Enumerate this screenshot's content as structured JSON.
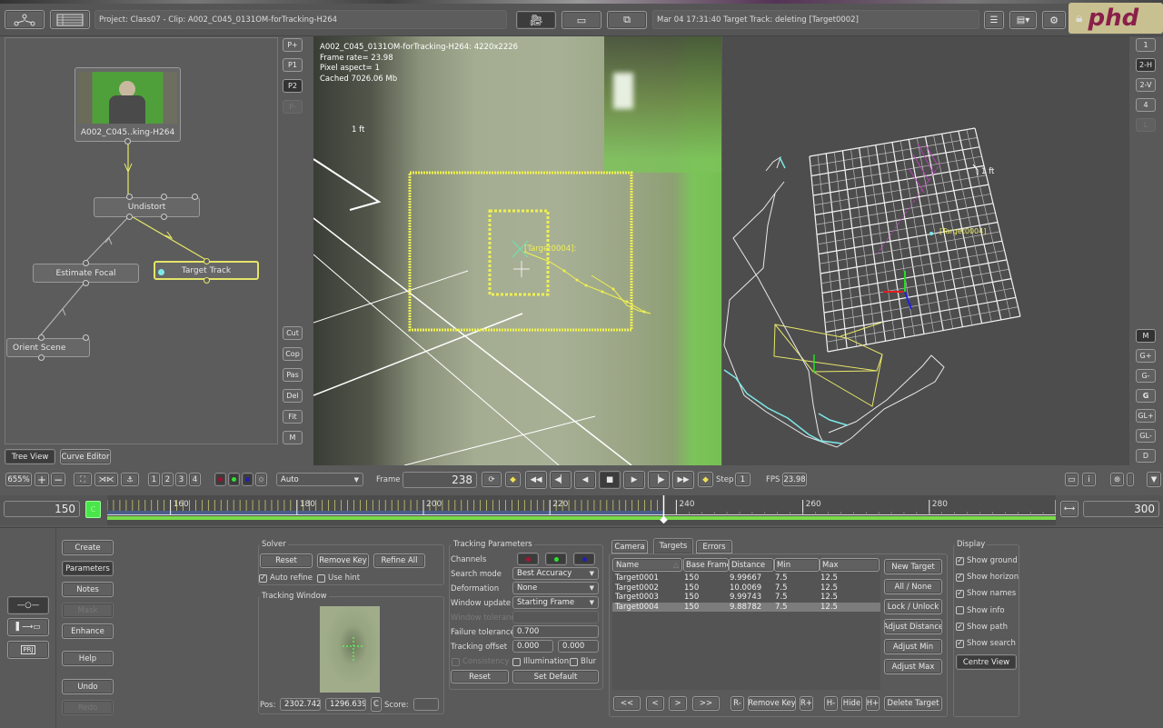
{
  "topbar": {
    "project_label": "Project: Class07 - Clip: A002_C045_0131OM-forTracking-H264",
    "status_message": "Mar 04 17:31:40 Target Track: deleting [Target0002]",
    "logo_text": "phd",
    "icons": [
      "node-tree-icon",
      "clip-list-icon",
      "camera-icon",
      "film-icon",
      "export-icon",
      "log-icon",
      "list-menu-icon",
      "gear-icon",
      "lock-icon"
    ]
  },
  "tree": {
    "nodes": [
      {
        "label": "A002_C045..king-H264"
      },
      {
        "label": "Undistort"
      },
      {
        "label": "Estimate Focal"
      },
      {
        "label": "Target Track"
      },
      {
        "label": "Orient Scene"
      }
    ],
    "tabs": [
      {
        "label": "Tree View"
      },
      {
        "label": "Curve Editor"
      }
    ],
    "side_buttons_top": [
      "P+",
      "P1",
      "P2",
      "P-"
    ],
    "side_buttons_bottom": [
      "Cut",
      "Cop",
      "Pas",
      "Del",
      "Fit",
      "M"
    ]
  },
  "viewer": {
    "info": [
      "A002_C045_0131OM-forTracking-H264: 4220x2226",
      "Frame rate= 23.98",
      "Pixel aspect= 1",
      "Cached 7026.06 Mb"
    ],
    "scale_label": "1 ft",
    "target_label": "[Target0004]:"
  },
  "view3d": {
    "scale_label": "1 ft",
    "target_label": "[Target0004]"
  },
  "right_buttons_top": [
    "1",
    "2-H",
    "2-V",
    "4",
    "L"
  ],
  "right_buttons_bottom": [
    "M",
    "G+",
    "G-",
    "G",
    "GL+",
    "GL-",
    "D"
  ],
  "toolbar": {
    "zoom": "655%",
    "zoom_in": "+",
    "zoom_out": "−",
    "layout_nums": [
      "1",
      "2",
      "3",
      "4"
    ],
    "channel_mode": "Auto",
    "frame_label": "Frame",
    "frame_value": "238",
    "step_label": "Step",
    "step_value": "1",
    "fps_label": "FPS",
    "fps_value": "23.98"
  },
  "timeline": {
    "start": "150",
    "end": "300",
    "current": 238,
    "range": [
      150,
      300
    ],
    "ticks": [
      "160",
      "180",
      "200",
      "220",
      "240",
      "260",
      "280",
      "300"
    ],
    "tracked_until": 238,
    "marker_label": "C"
  },
  "left_panel": {
    "buttons": [
      "Create",
      "Parameters",
      "Notes",
      "Mask",
      "Enhance",
      "Help",
      "Undo",
      "Redo"
    ],
    "mode_icons": [
      "slider-icon",
      "import-clip-icon",
      "project-icon"
    ],
    "project_icon_text": "PRJ"
  },
  "solver": {
    "title": "Solver",
    "reset": "Reset",
    "remove_key": "Remove Key",
    "refine_all": "Refine All",
    "auto_refine": {
      "label": "Auto refine",
      "checked": true
    },
    "use_hint": {
      "label": "Use hint",
      "checked": false
    }
  },
  "tracking_window": {
    "title": "Tracking Window",
    "pos_label": "Pos:",
    "pos_x": "2302.742",
    "pos_y": "1296.639",
    "c_label": "C",
    "score_label": "Score:",
    "score_value": ""
  },
  "tracking_params": {
    "title": "Tracking Parameters",
    "channels_label": "Channels",
    "channel_colors": [
      "#b01030",
      "#30e030",
      "#2020b0"
    ],
    "search_mode_label": "Search mode",
    "search_mode": "Best Accuracy",
    "deformation_label": "Deformation",
    "deformation": "None",
    "window_update_label": "Window update",
    "window_update": "Starting Frame",
    "window_tolerance_label": "Window tolerance",
    "window_tolerance": "",
    "failure_tolerance_label": "Failure tolerance",
    "failure_tolerance": "0.700",
    "tracking_offset_label": "Tracking offset",
    "offset_x": "0.000",
    "offset_y": "0.000",
    "consistency": {
      "label": "Consistency",
      "checked": false
    },
    "illumination": {
      "label": "Illumination",
      "checked": false
    },
    "blur": {
      "label": "Blur",
      "checked": false
    },
    "reset": "Reset",
    "set_default": "Set Default"
  },
  "targets": {
    "tabs": [
      "Camera",
      "Targets",
      "Errors"
    ],
    "active_tab": "Targets",
    "columns": [
      "Name",
      "Base Frame",
      "Distance",
      "Min",
      "Max"
    ],
    "rows": [
      {
        "name": "Target0001",
        "base": "150",
        "distance": "9.99667",
        "min": "7.5",
        "max": "12.5"
      },
      {
        "name": "Target0002",
        "base": "150",
        "distance": "10.0069",
        "min": "7.5",
        "max": "12.5"
      },
      {
        "name": "Target0003",
        "base": "150",
        "distance": "9.99743",
        "min": "7.5",
        "max": "12.5"
      },
      {
        "name": "Target0004",
        "base": "150",
        "distance": "9.88782",
        "min": "7.5",
        "max": "12.5"
      }
    ],
    "selected_row": 3,
    "side_buttons": [
      "New Target",
      "All / None",
      "Lock / Unlock",
      "Adjust Distance",
      "Adjust Min",
      "Adjust Max"
    ],
    "nav": [
      "<<",
      "<",
      ">",
      ">>"
    ],
    "r_minus": "R-",
    "remove_key": "Remove Key",
    "r_plus": "R+",
    "h_minus": "H-",
    "hide": "Hide",
    "h_plus": "H+",
    "delete_target": "Delete Target"
  },
  "display": {
    "title": "Display",
    "options": [
      {
        "label": "Show ground",
        "checked": true
      },
      {
        "label": "Show horizon",
        "checked": true
      },
      {
        "label": "Show names",
        "checked": true
      },
      {
        "label": "Show info",
        "checked": false
      },
      {
        "label": "Show path",
        "checked": true
      },
      {
        "label": "Show search",
        "checked": true
      }
    ],
    "centre_view": "Centre View"
  }
}
